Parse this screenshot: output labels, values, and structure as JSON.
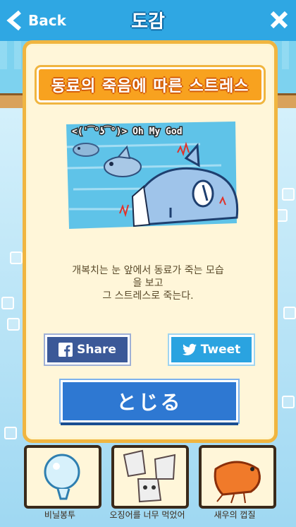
{
  "header": {
    "back_label": "Back",
    "title": "도감"
  },
  "card": {
    "badge_title": "동료의 죽음에 따른 스트레스",
    "scene_caption": "<(ˈ͡°ʖ͡°)> Oh My God",
    "description_lines": [
      "개복치는 눈 앞에서 동료가 죽는 모습",
      "을 보고",
      "그 스트레스로 죽는다."
    ],
    "share_label": "Share",
    "tweet_label": "Tweet",
    "close_label": "とじる"
  },
  "tiles": [
    {
      "label": "비닐봉투"
    },
    {
      "label": "오징어를 너무 먹었어"
    },
    {
      "label": "새우의 껍질"
    }
  ],
  "colors": {
    "topbar": "#2fa7e3",
    "card_border": "#f0b540",
    "badge": "#f8a21f",
    "facebook": "#3b5998",
    "twitter": "#2aa3e0",
    "close_button": "#2e78d2"
  },
  "icons": [
    "back-chevron-icon",
    "close-x-icon",
    "facebook-icon",
    "twitter-bird-icon"
  ]
}
